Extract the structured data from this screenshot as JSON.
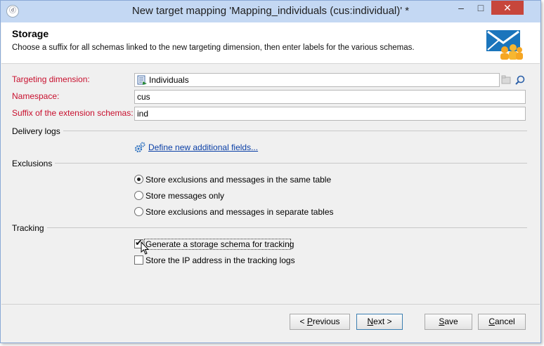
{
  "window": {
    "title": "New target mapping 'Mapping_individuals (cus:individual)' *",
    "app_icon_glyph": "ⓓ",
    "controls": {
      "minimize": "–",
      "maximize": "□",
      "close": "✕"
    }
  },
  "header": {
    "title": "Storage",
    "description": "Choose a suffix for all schemas linked to the new targeting dimension, then enter labels for the various schemas.",
    "icon": "email-audience-icon"
  },
  "form": {
    "targeting_dimension": {
      "label": "Targeting dimension:",
      "value": "Individuals"
    },
    "namespace": {
      "label": "Namespace:",
      "value": "cus"
    },
    "suffix": {
      "label": "Suffix of the extension schemas:",
      "value": "ind"
    }
  },
  "delivery_logs": {
    "heading": "Delivery logs",
    "link": "Define new additional fields..."
  },
  "exclusions": {
    "heading": "Exclusions",
    "options": [
      {
        "label": "Store exclusions and messages in the same table",
        "checked": true
      },
      {
        "label": "Store messages only",
        "checked": false
      },
      {
        "label": "Store exclusions and messages in separate tables",
        "checked": false
      }
    ]
  },
  "tracking": {
    "heading": "Tracking",
    "options": [
      {
        "label": "Generate a storage schema for tracking",
        "checked": true
      },
      {
        "label": "Store the IP address in the tracking logs",
        "checked": false
      }
    ]
  },
  "buttons": {
    "previous": {
      "prefix": "< ",
      "mnemonic": "P",
      "rest": "revious"
    },
    "next": {
      "mnemonic": "N",
      "rest": "ext >"
    },
    "save": {
      "mnemonic": "S",
      "rest": "ave"
    },
    "cancel": {
      "mnemonic": "C",
      "rest": "ancel"
    }
  },
  "colors": {
    "required_label": "#c8102e",
    "link": "#0a3fa6",
    "titlebar": "#c4d8f3",
    "close_button": "#c7463b"
  }
}
